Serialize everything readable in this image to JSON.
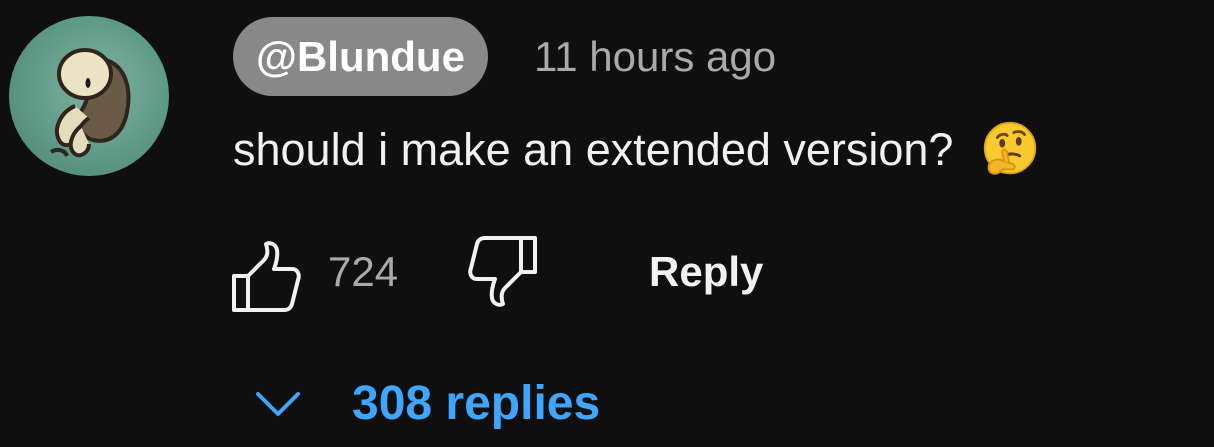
{
  "comment": {
    "author": "@Blundue",
    "timestamp": "11 hours ago",
    "text": "should i make an extended version?",
    "emoji": "thinking-face-icon",
    "avatar": "avatar-image"
  },
  "actions": {
    "like_icon": "thumbs-up-icon",
    "like_count": "724",
    "dislike_icon": "thumbs-down-icon",
    "reply_label": "Reply"
  },
  "replies": {
    "toggle_icon": "chevron-down-icon",
    "label": "308 replies"
  },
  "colors": {
    "background": "#0f0f0f",
    "author_chip": "#888888",
    "secondary_text": "#aaaaaa",
    "primary_text": "#f1f1f1",
    "link_blue": "#3ea6ff"
  }
}
